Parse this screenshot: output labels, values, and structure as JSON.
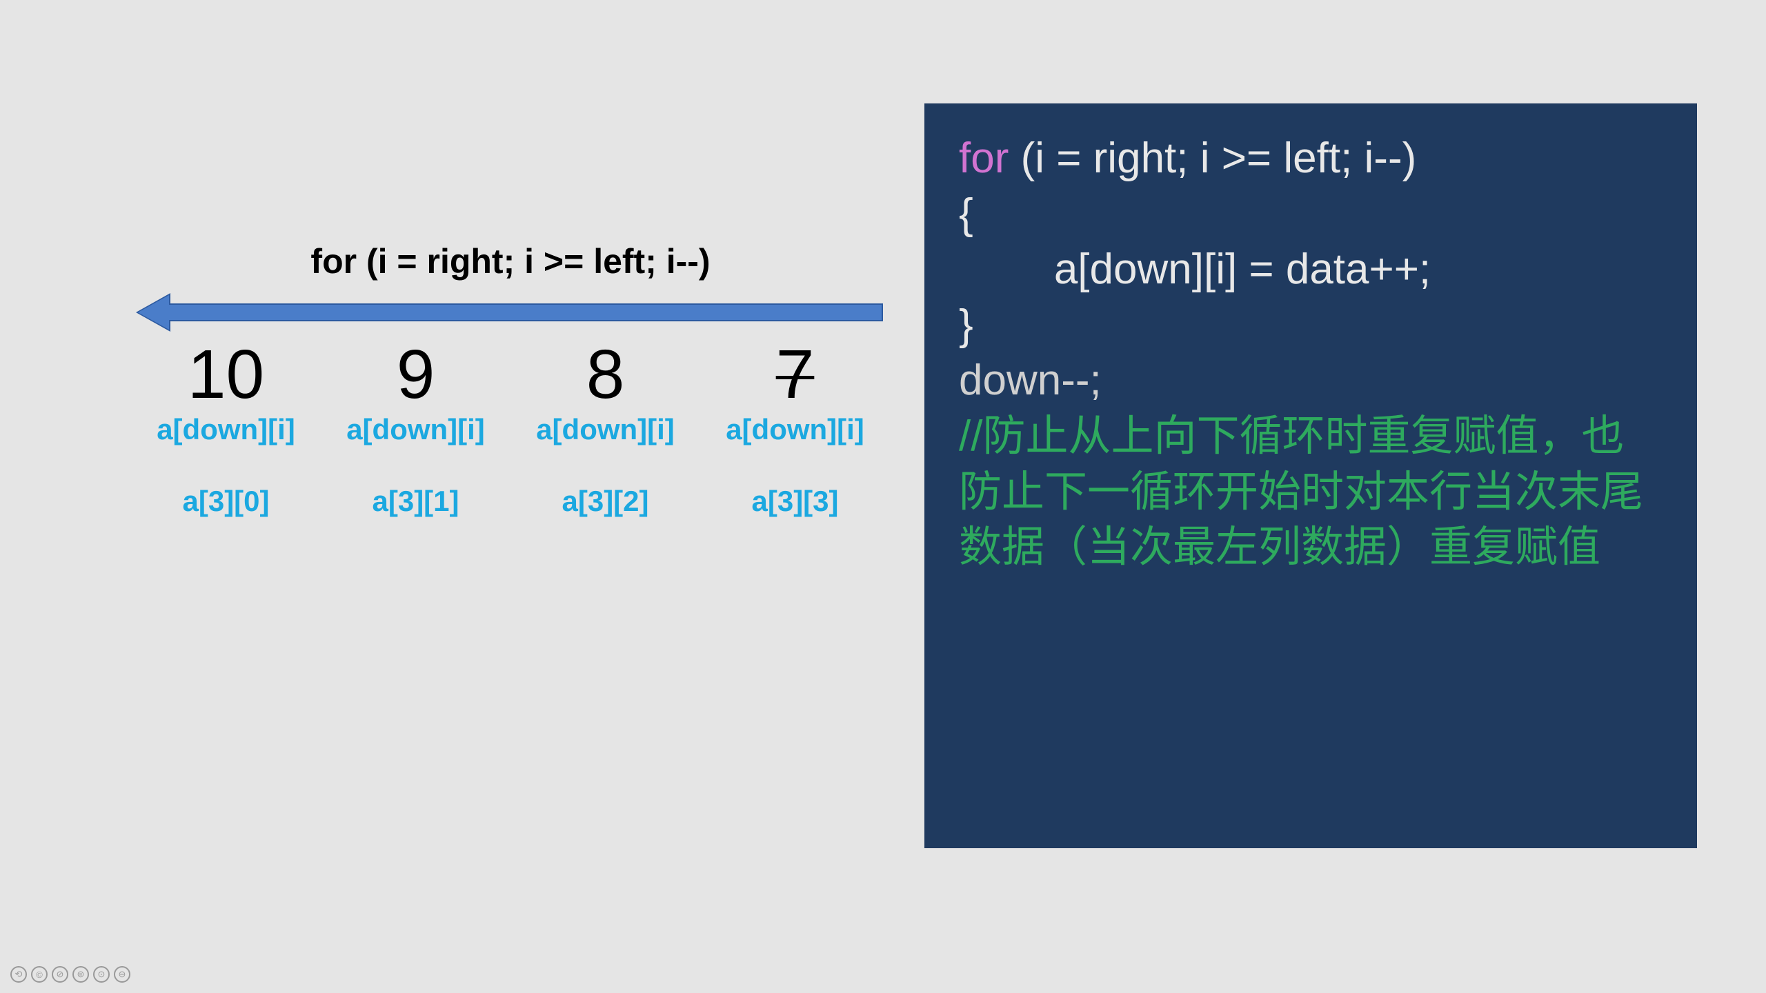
{
  "left": {
    "for_label": "for (i = right; i >= left; i--)",
    "cells": [
      {
        "num": "10",
        "sub1": "a[down][i]",
        "sub2": "a[3][0]",
        "strike": false
      },
      {
        "num": "9",
        "sub1": "a[down][i]",
        "sub2": "a[3][1]",
        "strike": false
      },
      {
        "num": "8",
        "sub1": "a[down][i]",
        "sub2": "a[3][2]",
        "strike": false
      },
      {
        "num": "7",
        "sub1": "a[down][i]",
        "sub2": "a[3][3]",
        "strike": true
      }
    ]
  },
  "code": {
    "line1_kw": "for",
    "line1_rest": " (i = right; i >= left; i--)",
    "line2": "{",
    "line3": "        a[down][i] = data++;",
    "line4": "}",
    "line5": "down--;",
    "comment": "//防止从上向下循环时重复赋值，也防止下一循环开始时对本行当次末尾数据（当次最左列数据）重复赋值"
  },
  "icons": [
    "⟲",
    "©",
    "⊘",
    "⊜",
    "⊙",
    "⊖"
  ]
}
